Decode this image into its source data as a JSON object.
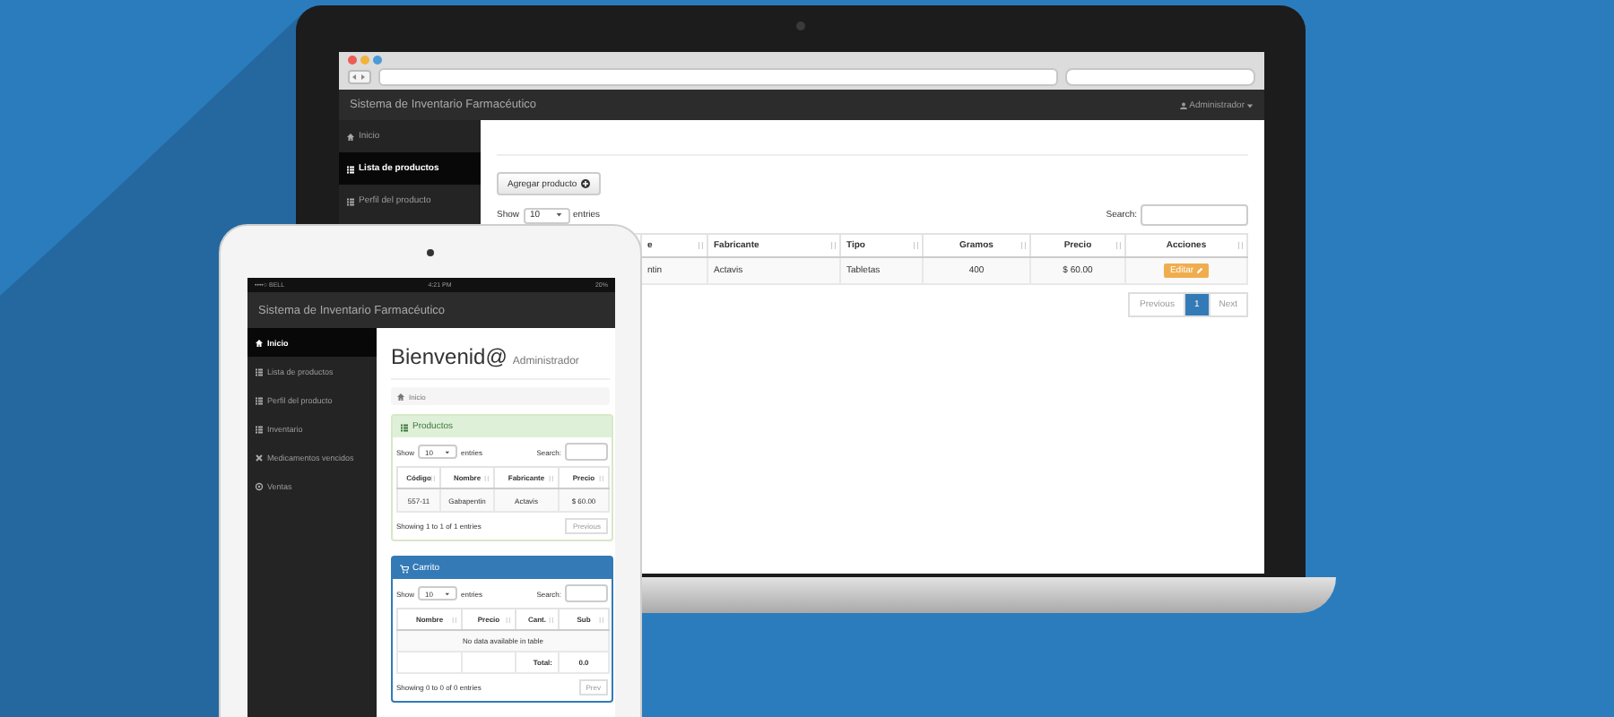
{
  "laptop": {
    "navbar": {
      "title": "Sistema de Inventario Farmacéutico",
      "user": "Administrador"
    },
    "sidebar": [
      {
        "label": "Inicio",
        "selected": false
      },
      {
        "label": "Lista de productos",
        "selected": true
      },
      {
        "label": "Perfil del producto",
        "selected": false
      }
    ],
    "add_button": "Agregar producto",
    "length": {
      "show": "Show",
      "value": "10",
      "entries": "entries"
    },
    "search_label": "Search:",
    "table": {
      "columns": [
        "e",
        "Fabricante",
        "Tipo",
        "Gramos",
        "Precio",
        "Acciones"
      ],
      "rows": [
        {
          "cells": [
            "ntin",
            "Actavis",
            "Tabletas",
            "400",
            "$ 60.00"
          ],
          "action": "Editar"
        }
      ]
    },
    "pagination": [
      {
        "label": "Previous",
        "selected": false
      },
      {
        "label": "1",
        "selected": true
      },
      {
        "label": "Next",
        "selected": false
      }
    ]
  },
  "tablet": {
    "status_bar": {
      "carrier": "••••○ BELL",
      "time": "4:21 PM",
      "battery": "20%"
    },
    "navbar_title": "Sistema de Inventario Farmacéutico",
    "sidebar": [
      {
        "label": "Inicio",
        "selected": true
      },
      {
        "label": "Lista de productos",
        "selected": false
      },
      {
        "label": "Perfil del producto",
        "selected": false
      },
      {
        "label": "Inventario",
        "selected": false
      },
      {
        "label": "Medicamentos vencidos",
        "selected": false
      },
      {
        "label": "Ventas",
        "selected": false
      }
    ],
    "heading": {
      "title": "Bienvenid@",
      "subtitle": "Administrador"
    },
    "breadcrumb": "Inicio",
    "panels": [
      {
        "kind": "success",
        "title": "Productos",
        "length": {
          "show": "Show",
          "value": "10",
          "entries": "entries"
        },
        "search_label": "Search:",
        "columns": [
          "Código",
          "Nombre",
          "Fabricante",
          "Precio"
        ],
        "rows": [
          {
            "kind": "data",
            "cells": [
              "557-11",
              "Gabapentin",
              "Actavis",
              "$ 60.00"
            ]
          }
        ],
        "info": "Showing 1 to 1 of 1 entries",
        "pager": "Previous"
      },
      {
        "kind": "primary",
        "title": "Carrito",
        "length": {
          "show": "Show",
          "value": "10",
          "entries": "entries"
        },
        "search_label": "Search:",
        "columns": [
          "Nombre",
          "Precio",
          "Cant.",
          "Sub"
        ],
        "rows": [
          {
            "kind": "empty",
            "cells": [
              {
                "text": "No data available in table",
                "colspan": 4
              }
            ]
          },
          {
            "kind": "total",
            "cells": [
              "",
              "",
              "Total:",
              "0.0"
            ]
          }
        ],
        "info": "Showing 0 to 0 of 0 entries",
        "pager": "Prev"
      }
    ]
  }
}
